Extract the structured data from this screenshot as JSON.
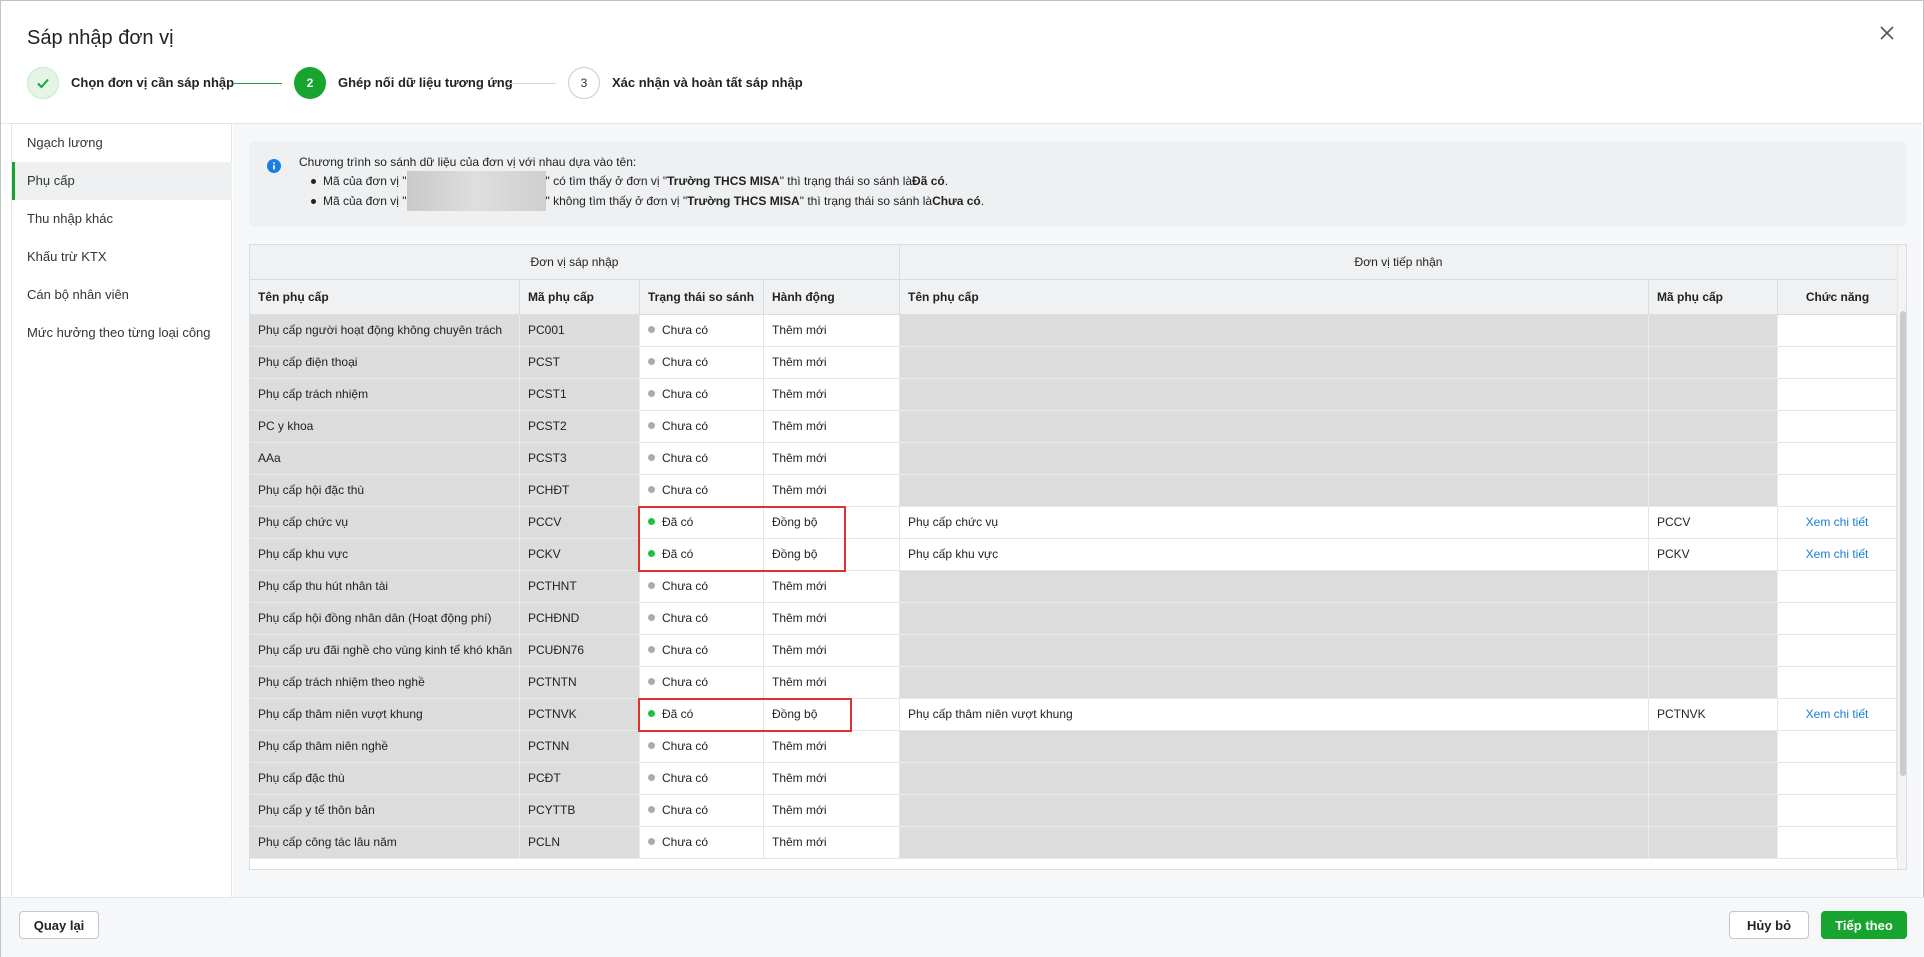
{
  "dialog": {
    "title": "Sáp nhập đơn vị",
    "close_icon": "close-icon"
  },
  "stepper": {
    "steps": [
      {
        "number": "",
        "label": "Chọn đơn vị cần sáp nhập",
        "state": "done"
      },
      {
        "number": "2",
        "label": "Ghép nối dữ liệu tương ứng",
        "state": "active"
      },
      {
        "number": "3",
        "label": "Xác nhận và hoàn tất sáp nhập",
        "state": "todo"
      }
    ]
  },
  "sidebar": {
    "items": [
      {
        "label": "Ngạch lương",
        "active": false
      },
      {
        "label": "Phụ cấp",
        "active": true
      },
      {
        "label": "Thu nhập khác",
        "active": false
      },
      {
        "label": "Khấu trừ KTX",
        "active": false
      },
      {
        "label": "Cán bộ nhân viên",
        "active": false
      },
      {
        "label": "Mức hưởng theo từng loại công",
        "active": false
      }
    ]
  },
  "info": {
    "intro": "Chương trình so sánh dữ liệu của đơn vị với nhau dựa vào tên:",
    "line1_prefix": "Mã của đơn vị \"",
    "line1_mid": "\" có tìm thấy ở đơn vị \"",
    "line1_unit": "Trường THCS MISA",
    "line1_after": "\" thì trạng thái so sánh là ",
    "line1_status": "Đã có",
    "line1_end": ".",
    "line2_prefix": "Mã của đơn vị \"",
    "line2_mid": "\" không tìm thấy ở đơn vị \"",
    "line2_unit": "Trường THCS MISA",
    "line2_after": "\" thì trạng thái so sánh là ",
    "line2_status": "Chưa có",
    "line2_end": "."
  },
  "grid": {
    "group_left": "Đơn vị sáp nhập",
    "group_right": "Đơn vị tiếp nhận",
    "columns": [
      "Tên phụ cấp",
      "Mã phụ cấp",
      "Trạng thái so sánh",
      "Hành động",
      "Tên phụ cấp",
      "Mã phụ cấp",
      "Chức năng"
    ],
    "rows": [
      {
        "name": "Phụ cấp người hoạt động không chuyên trách",
        "code": "PC001",
        "status": "Chưa có",
        "action": "Thêm mới",
        "target_name": "",
        "target_code": "",
        "func": ""
      },
      {
        "name": "Phụ cấp điện thoại",
        "code": "PCST",
        "status": "Chưa có",
        "action": "Thêm mới",
        "target_name": "",
        "target_code": "",
        "func": ""
      },
      {
        "name": "Phụ cấp trách nhiệm",
        "code": "PCST1",
        "status": "Chưa có",
        "action": "Thêm mới",
        "target_name": "",
        "target_code": "",
        "func": ""
      },
      {
        "name": "PC y khoa",
        "code": "PCST2",
        "status": "Chưa có",
        "action": "Thêm mới",
        "target_name": "",
        "target_code": "",
        "func": ""
      },
      {
        "name": "AAa",
        "code": "PCST3",
        "status": "Chưa có",
        "action": "Thêm mới",
        "target_name": "",
        "target_code": "",
        "func": ""
      },
      {
        "name": "Phụ cấp hội đặc thù",
        "code": "PCHĐT",
        "status": "Chưa có",
        "action": "Thêm mới",
        "target_name": "",
        "target_code": "",
        "func": ""
      },
      {
        "name": "Phụ cấp chức vụ",
        "code": "PCCV",
        "status": "Đã có",
        "action": "Đồng bộ",
        "target_name": "Phụ cấp chức vụ",
        "target_code": "PCCV",
        "func": "Xem chi tiết"
      },
      {
        "name": "Phụ cấp khu vực",
        "code": "PCKV",
        "status": "Đã có",
        "action": "Đồng bộ",
        "target_name": "Phụ cấp khu vực",
        "target_code": "PCKV",
        "func": "Xem chi tiết"
      },
      {
        "name": "Phụ cấp thu hút nhân tài",
        "code": "PCTHNT",
        "status": "Chưa có",
        "action": "Thêm mới",
        "target_name": "",
        "target_code": "",
        "func": ""
      },
      {
        "name": "Phụ cấp hội đồng nhân dân (Hoạt động phí)",
        "code": "PCHĐND",
        "status": "Chưa có",
        "action": "Thêm mới",
        "target_name": "",
        "target_code": "",
        "func": ""
      },
      {
        "name": "Phụ cấp ưu đãi nghề cho vùng kinh tế khó khăn",
        "code": "PCUĐN76",
        "status": "Chưa có",
        "action": "Thêm mới",
        "target_name": "",
        "target_code": "",
        "func": ""
      },
      {
        "name": "Phụ cấp trách nhiệm theo nghề",
        "code": "PCTNTN",
        "status": "Chưa có",
        "action": "Thêm mới",
        "target_name": "",
        "target_code": "",
        "func": ""
      },
      {
        "name": "Phụ cấp thâm niên vượt khung",
        "code": "PCTNVK",
        "status": "Đã có",
        "action": "Đồng bộ",
        "target_name": "Phụ cấp thâm niên vượt khung",
        "target_code": "PCTNVK",
        "func": "Xem chi tiết"
      },
      {
        "name": "Phụ cấp thâm niên nghề",
        "code": "PCTNN",
        "status": "Chưa có",
        "action": "Thêm mới",
        "target_name": "",
        "target_code": "",
        "func": ""
      },
      {
        "name": "Phụ cấp đặc thù",
        "code": "PCĐT",
        "status": "Chưa có",
        "action": "Thêm mới",
        "target_name": "",
        "target_code": "",
        "func": ""
      },
      {
        "name": "Phụ cấp y tế thôn bản",
        "code": "PCYTTB",
        "status": "Chưa có",
        "action": "Thêm mới",
        "target_name": "",
        "target_code": "",
        "func": ""
      },
      {
        "name": "Phụ cấp công tác lâu năm",
        "code": "PCLN",
        "status": "Chưa có",
        "action": "Thêm mới",
        "target_name": "",
        "target_code": "",
        "func": ""
      }
    ]
  },
  "colors": {
    "accent": "#17a52f",
    "status_exists": "#1fc04a",
    "status_missing": "#a9adb2",
    "link": "#1a7ee0",
    "highlight": "#e03131"
  },
  "footer": {
    "back_label": "Quay lại",
    "cancel_label": "Hủy bỏ",
    "next_label": "Tiếp theo"
  }
}
